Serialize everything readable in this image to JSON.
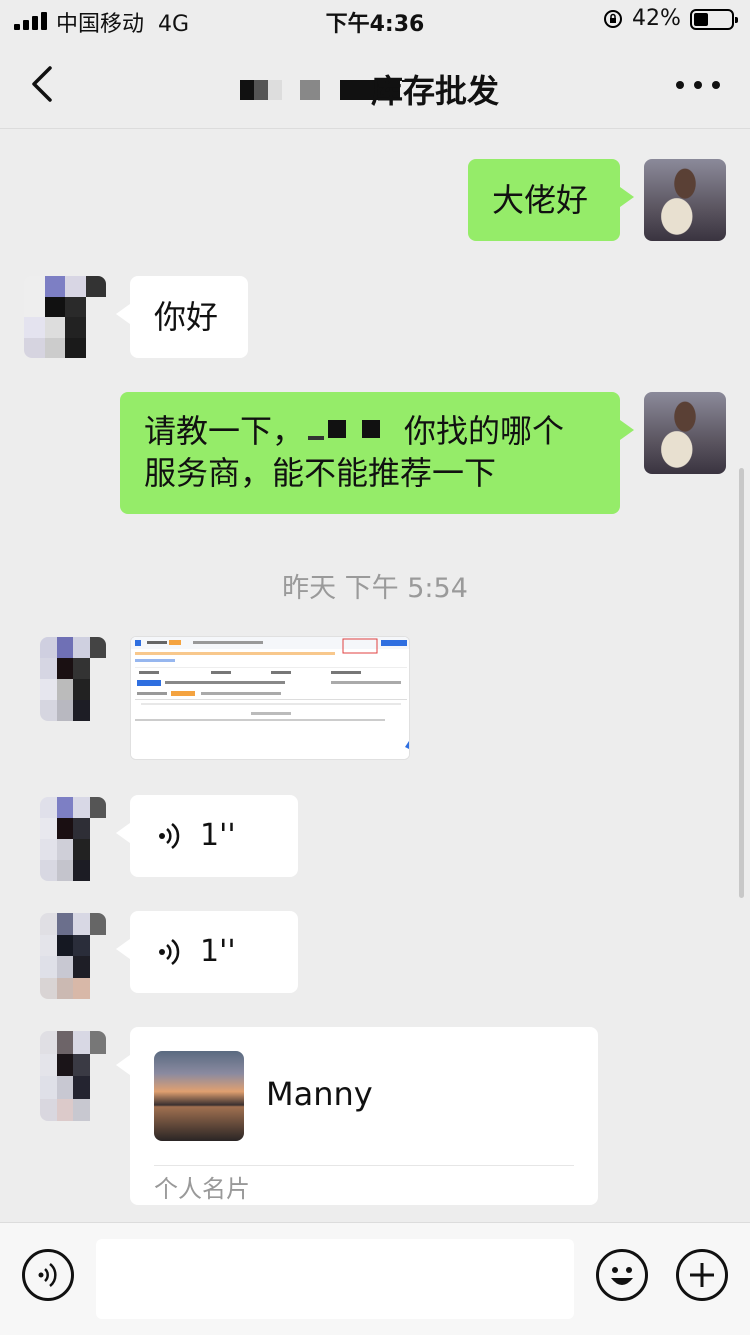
{
  "status": {
    "carrier": "中国移动",
    "network": "4G",
    "time": "下午4:36",
    "battery_pct": "42%",
    "battery_level": 0.42
  },
  "nav": {
    "title": "库存批发",
    "back_icon": "chevron-left-icon",
    "more_icon": "more-dots-icon"
  },
  "messages": [
    {
      "side": "right",
      "type": "text",
      "text": "大佬好"
    },
    {
      "side": "left",
      "type": "text",
      "text": "你好"
    },
    {
      "side": "right",
      "type": "text",
      "line1_a": "请教一下，",
      "line1_b": "你找的哪个",
      "line2": "服务商，能不能推荐一下"
    },
    {
      "type": "timestamp",
      "text": "昨天 下午 5:54"
    },
    {
      "side": "left",
      "type": "image"
    },
    {
      "side": "left",
      "type": "voice",
      "duration": "1''"
    },
    {
      "side": "left",
      "type": "voice",
      "duration": "1''"
    },
    {
      "side": "left",
      "type": "contact_card",
      "name": "Manny",
      "card_type": "个人名片"
    }
  ],
  "colors": {
    "background": "#ededed",
    "sent_bubble": "#95ec69",
    "received_bubble": "#ffffff",
    "timestamp": "#9a9a9a"
  }
}
